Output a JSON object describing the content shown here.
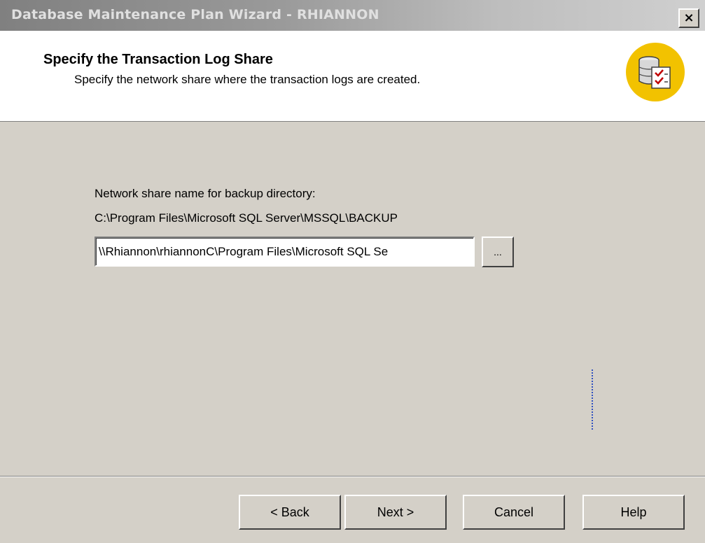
{
  "window": {
    "title": "Database Maintenance Plan Wizard - RHIANNON",
    "close_glyph": "×"
  },
  "header": {
    "title": "Specify the Transaction Log Share",
    "description": "Specify the network share where the transaction logs are created.",
    "icon": "database-checklist-icon"
  },
  "form": {
    "share_label": "Network share name for backup directory:",
    "current_path": "C:\\Program Files\\Microsoft SQL Server\\MSSQL\\BACKUP",
    "share_value": "\\\\Rhiannon\\rhiannonC\\Program Files\\Microsoft SQL Se",
    "browse_label": "..."
  },
  "footer": {
    "back_label": "< Back",
    "next_label": "Next >",
    "cancel_label": "Cancel",
    "help_label": "Help"
  },
  "colors": {
    "dialog_bg": "#d4d0c8",
    "header_bg": "#ffffff",
    "icon_accent": "#f2c200"
  }
}
